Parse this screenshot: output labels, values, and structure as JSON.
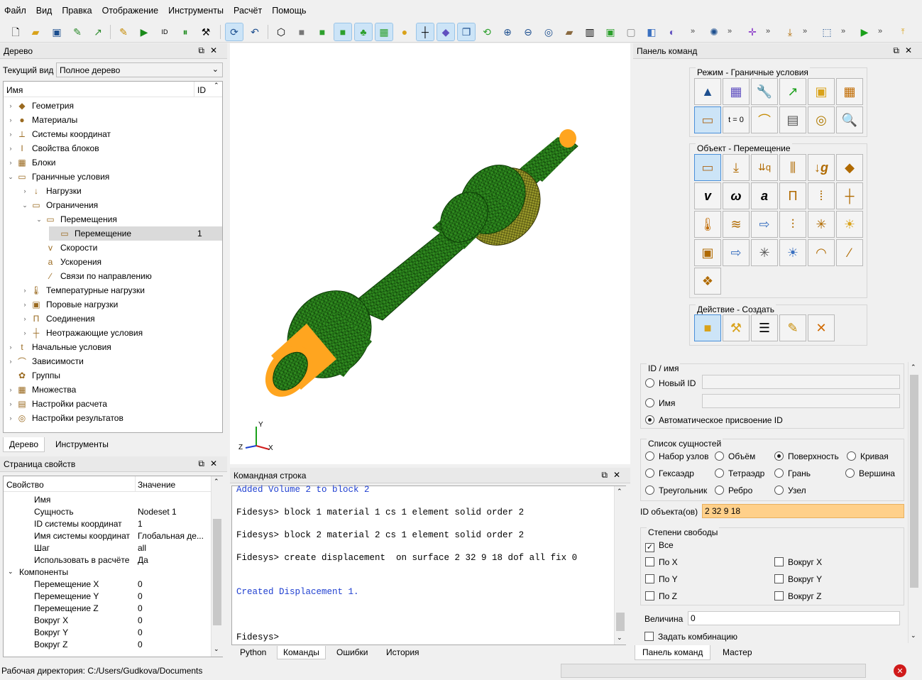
{
  "menu": [
    "Файл",
    "Вид",
    "Правка",
    "Отображение",
    "Инструменты",
    "Расчёт",
    "Помощь"
  ],
  "tree_panel": {
    "title": "Дерево",
    "view_label": "Текущий вид",
    "view_value": "Полное дерево",
    "col_name": "Имя",
    "col_id": "ID",
    "items": [
      {
        "label": "Геометрия",
        "indent": 0,
        "arrow": "›",
        "icon": "◆",
        "id": ""
      },
      {
        "label": "Материалы",
        "indent": 0,
        "arrow": "›",
        "icon": "●",
        "id": ""
      },
      {
        "label": "Системы координат",
        "indent": 0,
        "arrow": "›",
        "icon": "⟂",
        "id": ""
      },
      {
        "label": "Свойства блоков",
        "indent": 0,
        "arrow": "›",
        "icon": "I",
        "id": ""
      },
      {
        "label": "Блоки",
        "indent": 0,
        "arrow": "›",
        "icon": "▦",
        "id": ""
      },
      {
        "label": "Граничные условия",
        "indent": 0,
        "arrow": "⌄",
        "icon": "▭",
        "id": ""
      },
      {
        "label": "Нагрузки",
        "indent": 1,
        "arrow": "›",
        "icon": "↓",
        "id": ""
      },
      {
        "label": "Ограничения",
        "indent": 1,
        "arrow": "⌄",
        "icon": "▭",
        "id": ""
      },
      {
        "label": "Перемещения",
        "indent": 2,
        "arrow": "⌄",
        "icon": "▭",
        "id": ""
      },
      {
        "label": "Перемещение",
        "indent": 3,
        "arrow": "",
        "icon": "▭",
        "id": "1"
      },
      {
        "label": "Скорости",
        "indent": 2,
        "arrow": "",
        "icon": "v",
        "id": ""
      },
      {
        "label": "Ускорения",
        "indent": 2,
        "arrow": "",
        "icon": "a",
        "id": ""
      },
      {
        "label": "Связи по направлению",
        "indent": 2,
        "arrow": "",
        "icon": "∕",
        "id": ""
      },
      {
        "label": "Температурные нагрузки",
        "indent": 1,
        "arrow": "›",
        "icon": "🌡",
        "id": ""
      },
      {
        "label": "Поровые нагрузки",
        "indent": 1,
        "arrow": "›",
        "icon": "▣",
        "id": ""
      },
      {
        "label": "Соединения",
        "indent": 1,
        "arrow": "›",
        "icon": "Π",
        "id": ""
      },
      {
        "label": "Неотражающие условия",
        "indent": 1,
        "arrow": "›",
        "icon": "┼",
        "id": ""
      },
      {
        "label": "Начальные условия",
        "indent": 0,
        "arrow": "›",
        "icon": "t",
        "id": ""
      },
      {
        "label": "Зависимости",
        "indent": 0,
        "arrow": "›",
        "icon": "⌒",
        "id": ""
      },
      {
        "label": "Группы",
        "indent": 0,
        "arrow": "",
        "icon": "✿",
        "id": ""
      },
      {
        "label": "Множества",
        "indent": 0,
        "arrow": "›",
        "icon": "▦",
        "id": ""
      },
      {
        "label": "Настройки расчета",
        "indent": 0,
        "arrow": "›",
        "icon": "▤",
        "id": ""
      },
      {
        "label": "Настройки результатов",
        "indent": 0,
        "arrow": "›",
        "icon": "◎",
        "id": ""
      }
    ],
    "tabs": [
      "Дерево",
      "Инструменты"
    ]
  },
  "props_panel": {
    "title": "Страница свойств",
    "col_prop": "Свойство",
    "col_val": "Значение",
    "rows": [
      {
        "k": "Имя",
        "v": "",
        "indent": 1
      },
      {
        "k": "Сущность",
        "v": "Nodeset 1",
        "indent": 1
      },
      {
        "k": "ID системы координат",
        "v": "1",
        "indent": 1
      },
      {
        "k": "Имя системы координат",
        "v": "Глобальная де...",
        "indent": 1
      },
      {
        "k": "Шаг",
        "v": "all",
        "indent": 1
      },
      {
        "k": "Использовать в расчёте",
        "v": "Да",
        "indent": 1
      },
      {
        "k": "Компоненты",
        "v": "",
        "indent": 0
      },
      {
        "k": "Перемещение X",
        "v": "0",
        "indent": 1
      },
      {
        "k": "Перемещение Y",
        "v": "0",
        "indent": 1
      },
      {
        "k": "Перемещение Z",
        "v": "0",
        "indent": 1
      },
      {
        "k": "Вокруг X",
        "v": "0",
        "indent": 1
      },
      {
        "k": "Вокруг Y",
        "v": "0",
        "indent": 1
      },
      {
        "k": "Вокруг Z",
        "v": "0",
        "indent": 1
      }
    ]
  },
  "viewport": {
    "axis_x": "X",
    "axis_y": "Y",
    "axis_z": "Z"
  },
  "cmdline": {
    "title": "Командная строка",
    "lines": [
      {
        "t": "Added Volume 2 to block 2",
        "c": "#1f3fd0"
      },
      {
        "t": "",
        "c": "#000"
      },
      {
        "t": "Fidesys> block 1 material 1 cs 1 element solid order 2",
        "c": "#000"
      },
      {
        "t": "",
        "c": "#000"
      },
      {
        "t": "Fidesys> block 2 material 2 cs 1 element solid order 2",
        "c": "#000"
      },
      {
        "t": "",
        "c": "#000"
      },
      {
        "t": "Fidesys> create displacement  on surface 2 32 9 18 dof all fix 0",
        "c": "#000"
      },
      {
        "t": "",
        "c": "#000"
      },
      {
        "t": "",
        "c": "#000"
      },
      {
        "t": "Created Displacement 1.",
        "c": "#1f3fd0"
      },
      {
        "t": "",
        "c": "#000"
      },
      {
        "t": "",
        "c": "#000"
      },
      {
        "t": "",
        "c": "#000"
      },
      {
        "t": "Fidesys>",
        "c": "#000"
      }
    ],
    "tabs": [
      "Python",
      "Команды",
      "Ошибки",
      "История"
    ]
  },
  "cmd_panel": {
    "title": "Панель команд",
    "mode_title": "Режим - Граничные условия",
    "object_title": "Объект - Перемещение",
    "action_title": "Действие - Создать",
    "id_group": "ID / имя",
    "new_id": "Новый ID",
    "name": "Имя",
    "auto_id": "Автоматическое присвоение ID",
    "entity_group": "Список сущностей",
    "entities": [
      "Набор узлов",
      "Объём",
      "Поверхность",
      "Кривая",
      "Гексаэдр",
      "Тетраэдр",
      "Грань",
      "Вершина",
      "Треугольник",
      "Ребро",
      "Узел"
    ],
    "object_ids_label": "ID объекта(ов)",
    "object_ids_value": "2 32 9 18",
    "dof_group": "Степени свободы",
    "dof_all": "Все",
    "dof_x": "По X",
    "dof_y": "По Y",
    "dof_z": "По Z",
    "rot_x": "Вокруг X",
    "rot_y": "Вокруг Y",
    "rot_z": "Вокруг Z",
    "magnitude_label": "Величина",
    "magnitude_value": "0",
    "combination": "Задать комбинацию",
    "tabs": [
      "Панель команд",
      "Мастер"
    ],
    "mode_t0": "t = 0"
  },
  "status": {
    "workdir": "Рабочая директория: C:/Users/Gudkova/Documents"
  },
  "colors": {
    "mesh_green": "#2f8a1f",
    "mesh_orange": "#ffa51f",
    "ids_bg": "#ffd08a"
  }
}
